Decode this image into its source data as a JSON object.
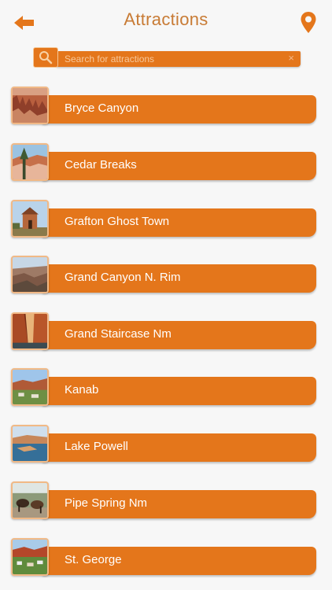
{
  "header": {
    "title": "Attractions",
    "back_icon": "back-arrow-icon",
    "location_icon": "map-pin-icon"
  },
  "search": {
    "placeholder": "Search for attractions",
    "clear_label": "×"
  },
  "colors": {
    "accent": "#e4761b",
    "title": "#c87b35",
    "background": "#f7f7f7"
  },
  "items": [
    {
      "label": "Bryce Canyon"
    },
    {
      "label": "Cedar Breaks"
    },
    {
      "label": "Grafton Ghost Town"
    },
    {
      "label": "Grand Canyon N. Rim"
    },
    {
      "label": "Grand Staircase Nm"
    },
    {
      "label": "Kanab"
    },
    {
      "label": "Lake Powell"
    },
    {
      "label": "Pipe Spring Nm"
    },
    {
      "label": "St. George"
    }
  ]
}
